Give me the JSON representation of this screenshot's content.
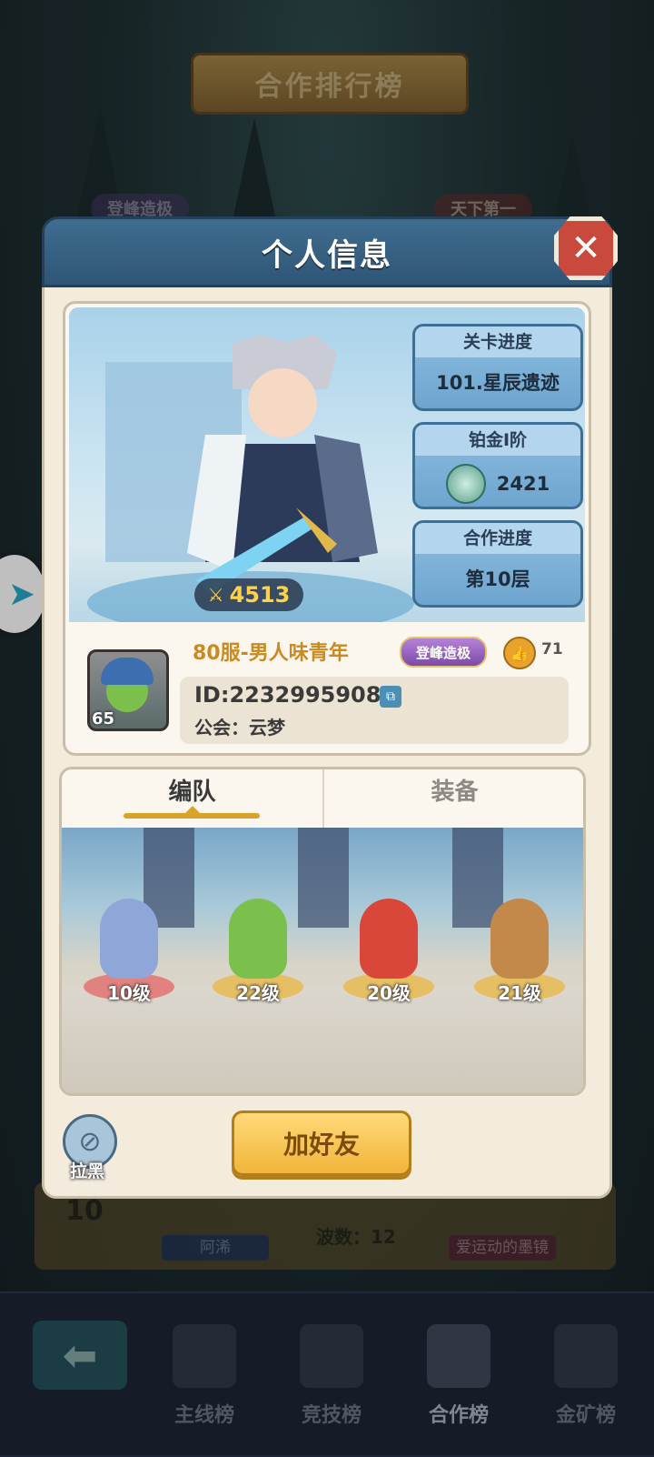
{
  "background": {
    "leaderboard_title": "合作排行榜",
    "badge_left": "登峰造极",
    "badge_right": "天下第一",
    "row": {
      "rank": "10",
      "player_left": "阿浠",
      "waves": "波数：12",
      "player_right": "爱运动的墨镜"
    }
  },
  "bottom_nav": {
    "items": [
      {
        "label": "主线榜"
      },
      {
        "label": "竞技榜"
      },
      {
        "label": "合作榜"
      },
      {
        "label": "金矿榜"
      }
    ]
  },
  "modal": {
    "title": "个人信息",
    "hero": {
      "power": "4513"
    },
    "stats": {
      "stage_title": "关卡进度",
      "stage_value": "101.星辰遗迹",
      "rank_title": "铂金I阶",
      "rank_value": "2421",
      "coop_title": "合作进度",
      "coop_value": "第10层"
    },
    "player": {
      "level": "65",
      "name": "80服-男人味青年",
      "title_badge": "登峰造极",
      "likes": "71",
      "id": "ID:2232995908",
      "guild": "公会：云梦"
    },
    "tabs": [
      {
        "label": "编队"
      },
      {
        "label": "装备"
      }
    ],
    "team": [
      {
        "level": "10级",
        "color": "#8fa7d8"
      },
      {
        "level": "22级",
        "color": "#7bbf4c"
      },
      {
        "level": "20级",
        "color": "#d9473a"
      },
      {
        "level": "21级",
        "color": "#c2894a"
      }
    ],
    "block_label": "拉黑",
    "add_friend_label": "加好友"
  }
}
